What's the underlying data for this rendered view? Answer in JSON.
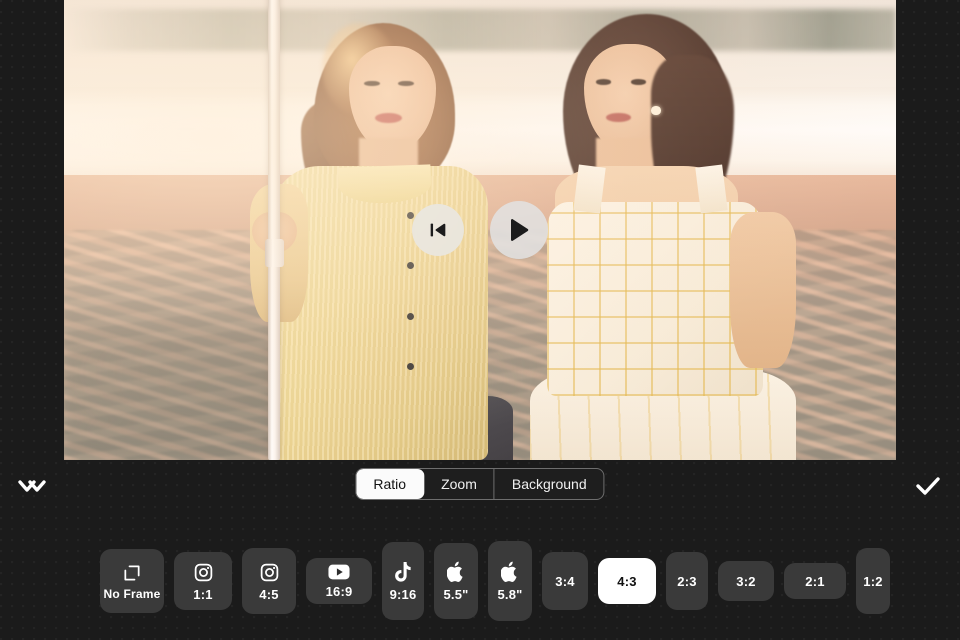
{
  "app": {
    "theme_background": "#1b1b1b",
    "panel_color": "#3a3a3a",
    "accent_color": "#ffffff"
  },
  "preview": {
    "media_type": "video",
    "scene_description": "Two women sitting on a sunlit beach at sunset with a white umbrella pole",
    "controls": {
      "rewind_icon": "skip-back-icon",
      "play_icon": "play-icon"
    }
  },
  "bottom_bar": {
    "cancel_icon": "double-chevron-icon",
    "confirm_icon": "check-icon",
    "tabs": [
      {
        "label": "Ratio",
        "selected": true
      },
      {
        "label": "Zoom",
        "selected": false
      },
      {
        "label": "Background",
        "selected": false
      }
    ],
    "ratios": [
      {
        "label": "No Frame",
        "icon": "crop-frame-icon",
        "selected": false,
        "size_class": "sz-noframe",
        "extra_class": "no-frame"
      },
      {
        "label": "1:1",
        "icon": "instagram-icon",
        "selected": false,
        "size_class": "sz-1-1",
        "extra_class": ""
      },
      {
        "label": "4:5",
        "icon": "instagram-icon",
        "selected": false,
        "size_class": "sz-4-5",
        "extra_class": ""
      },
      {
        "label": "16:9",
        "icon": "youtube-icon",
        "selected": false,
        "size_class": "sz-16-9",
        "extra_class": ""
      },
      {
        "label": "9:16",
        "icon": "tiktok-icon",
        "selected": false,
        "size_class": "sz-9-16",
        "extra_class": ""
      },
      {
        "label": "5.5\"",
        "icon": "apple-icon",
        "selected": false,
        "size_class": "sz-55",
        "extra_class": ""
      },
      {
        "label": "5.8\"",
        "icon": "apple-icon",
        "selected": false,
        "size_class": "sz-58",
        "extra_class": ""
      },
      {
        "label": "3:4",
        "icon": "none",
        "selected": false,
        "size_class": "sz-3-4",
        "extra_class": ""
      },
      {
        "label": "4:3",
        "icon": "none",
        "selected": true,
        "size_class": "sz-4-3",
        "extra_class": ""
      },
      {
        "label": "2:3",
        "icon": "none",
        "selected": false,
        "size_class": "sz-2-3",
        "extra_class": ""
      },
      {
        "label": "3:2",
        "icon": "none",
        "selected": false,
        "size_class": "sz-3-2",
        "extra_class": ""
      },
      {
        "label": "2:1",
        "icon": "none",
        "selected": false,
        "size_class": "sz-2-1",
        "extra_class": ""
      },
      {
        "label": "1:2",
        "icon": "none",
        "selected": false,
        "size_class": "sz-1-2",
        "extra_class": ""
      }
    ]
  }
}
